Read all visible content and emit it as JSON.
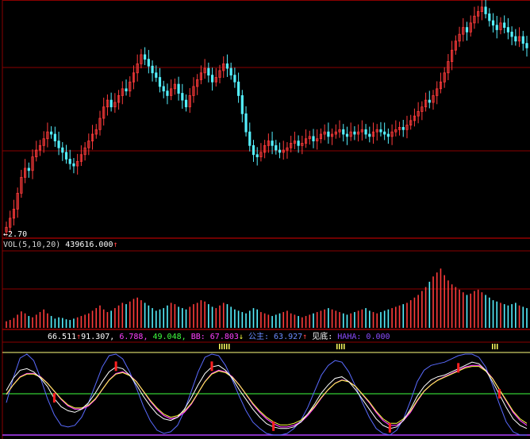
{
  "colors": {
    "up": "#ff3b3b",
    "down": "#54f0ff",
    "grid": "#8a0000",
    "kline": "#ffffff",
    "dline": "#ffff40",
    "jline": "#ff40ff",
    "bline": "#5a6bff",
    "green": "#40ff40"
  },
  "price_panel": {
    "low_label": "2.70"
  },
  "volume_panel": {
    "title": "VOL(5,10,20)",
    "value": "439616.000",
    "arrow": "↑"
  },
  "indicator_panel": {
    "v1": "66.511",
    "a1": "↑",
    "v2": "91.307,",
    "v3": "6.788,",
    "v4": "49.048,",
    "bb_label": "BB:",
    "bb_value": "67.803",
    "a2": "↓",
    "gz_label": "公主:",
    "gz_value": "63.927",
    "a3": "↑",
    "jd_label": "见底:",
    "haha_label": "HAHA:",
    "haha_value": "0.000"
  },
  "chart_data": {
    "type": "candlestick",
    "price_low_marker": 2.7,
    "note_values": "Bars read approximately from screenshot (relative scale)",
    "candles_close": [
      0.02,
      0.06,
      0.1,
      0.17,
      0.24,
      0.28,
      0.27,
      0.33,
      0.36,
      0.38,
      0.41,
      0.44,
      0.43,
      0.4,
      0.37,
      0.35,
      0.32,
      0.3,
      0.29,
      0.31,
      0.34,
      0.37,
      0.4,
      0.43,
      0.45,
      0.5,
      0.55,
      0.58,
      0.55,
      0.57,
      0.6,
      0.63,
      0.62,
      0.66,
      0.7,
      0.74,
      0.78,
      0.76,
      0.73,
      0.7,
      0.68,
      0.64,
      0.62,
      0.6,
      0.63,
      0.65,
      0.61,
      0.58,
      0.55,
      0.6,
      0.64,
      0.67,
      0.7,
      0.72,
      0.69,
      0.66,
      0.68,
      0.71,
      0.74,
      0.72,
      0.69,
      0.66,
      0.6,
      0.52,
      0.44,
      0.38,
      0.34,
      0.33,
      0.35,
      0.38,
      0.4,
      0.38,
      0.36,
      0.35,
      0.36,
      0.37,
      0.39,
      0.4,
      0.38,
      0.39,
      0.41,
      0.42,
      0.4,
      0.41,
      0.43,
      0.44,
      0.42,
      0.43,
      0.44,
      0.45,
      0.43,
      0.42,
      0.44,
      0.43,
      0.44,
      0.45,
      0.43,
      0.42,
      0.44,
      0.45,
      0.44,
      0.43,
      0.42,
      0.44,
      0.45,
      0.46,
      0.45,
      0.47,
      0.49,
      0.51,
      0.53,
      0.55,
      0.58,
      0.57,
      0.6,
      0.63,
      0.66,
      0.7,
      0.75,
      0.8,
      0.84,
      0.87,
      0.9,
      0.88,
      0.92,
      0.95,
      0.97,
      0.99,
      0.96,
      0.93,
      0.91,
      0.89,
      0.92,
      0.9,
      0.88,
      0.86,
      0.84,
      0.86,
      0.83,
      0.81
    ],
    "volume": [
      0.1,
      0.12,
      0.15,
      0.2,
      0.25,
      0.22,
      0.18,
      0.16,
      0.2,
      0.24,
      0.28,
      0.22,
      0.18,
      0.14,
      0.16,
      0.15,
      0.13,
      0.12,
      0.14,
      0.16,
      0.18,
      0.2,
      0.22,
      0.26,
      0.3,
      0.34,
      0.28,
      0.24,
      0.26,
      0.3,
      0.34,
      0.38,
      0.36,
      0.4,
      0.44,
      0.46,
      0.42,
      0.38,
      0.34,
      0.3,
      0.26,
      0.28,
      0.3,
      0.34,
      0.38,
      0.36,
      0.32,
      0.3,
      0.28,
      0.32,
      0.36,
      0.38,
      0.42,
      0.4,
      0.36,
      0.32,
      0.3,
      0.34,
      0.38,
      0.36,
      0.32,
      0.28,
      0.26,
      0.24,
      0.22,
      0.26,
      0.3,
      0.28,
      0.24,
      0.22,
      0.2,
      0.18,
      0.2,
      0.22,
      0.24,
      0.26,
      0.22,
      0.2,
      0.18,
      0.16,
      0.18,
      0.2,
      0.22,
      0.24,
      0.26,
      0.28,
      0.3,
      0.28,
      0.26,
      0.24,
      0.22,
      0.2,
      0.22,
      0.24,
      0.26,
      0.28,
      0.3,
      0.26,
      0.24,
      0.22,
      0.24,
      0.26,
      0.28,
      0.3,
      0.32,
      0.34,
      0.36,
      0.38,
      0.42,
      0.46,
      0.5,
      0.56,
      0.62,
      0.7,
      0.78,
      0.84,
      0.9,
      0.8,
      0.72,
      0.66,
      0.62,
      0.58,
      0.54,
      0.5,
      0.52,
      0.56,
      0.58,
      0.54,
      0.5,
      0.46,
      0.42,
      0.4,
      0.38,
      0.36,
      0.34,
      0.36,
      0.38,
      0.34,
      0.32,
      0.3
    ],
    "osc_k": [
      0.55,
      0.7,
      0.8,
      0.82,
      0.78,
      0.7,
      0.6,
      0.45,
      0.35,
      0.3,
      0.28,
      0.32,
      0.4,
      0.52,
      0.66,
      0.78,
      0.84,
      0.82,
      0.74,
      0.62,
      0.48,
      0.36,
      0.26,
      0.2,
      0.18,
      0.22,
      0.32,
      0.46,
      0.62,
      0.76,
      0.84,
      0.86,
      0.8,
      0.7,
      0.56,
      0.44,
      0.32,
      0.22,
      0.14,
      0.1,
      0.08,
      0.08,
      0.1,
      0.16,
      0.26,
      0.38,
      0.52,
      0.62,
      0.7,
      0.72,
      0.66,
      0.56,
      0.44,
      0.32,
      0.2,
      0.12,
      0.08,
      0.1,
      0.18,
      0.32,
      0.48,
      0.6,
      0.68,
      0.72,
      0.74,
      0.78,
      0.82,
      0.86,
      0.9,
      0.88,
      0.8,
      0.66,
      0.5,
      0.34,
      0.2,
      0.12,
      0.08
    ],
    "osc_d": [
      0.5,
      0.62,
      0.72,
      0.76,
      0.76,
      0.72,
      0.64,
      0.54,
      0.44,
      0.36,
      0.32,
      0.32,
      0.36,
      0.44,
      0.56,
      0.68,
      0.76,
      0.78,
      0.74,
      0.66,
      0.54,
      0.42,
      0.32,
      0.24,
      0.2,
      0.22,
      0.28,
      0.38,
      0.52,
      0.66,
      0.76,
      0.8,
      0.78,
      0.72,
      0.62,
      0.5,
      0.38,
      0.28,
      0.2,
      0.14,
      0.1,
      0.1,
      0.12,
      0.16,
      0.24,
      0.34,
      0.46,
      0.56,
      0.64,
      0.68,
      0.66,
      0.6,
      0.5,
      0.4,
      0.28,
      0.18,
      0.12,
      0.12,
      0.18,
      0.28,
      0.42,
      0.54,
      0.62,
      0.68,
      0.72,
      0.76,
      0.8,
      0.84,
      0.86,
      0.86,
      0.8,
      0.7,
      0.56,
      0.42,
      0.28,
      0.18,
      0.12
    ],
    "osc_b": [
      0.4,
      0.7,
      0.95,
      1.0,
      0.92,
      0.7,
      0.45,
      0.25,
      0.12,
      0.1,
      0.12,
      0.22,
      0.4,
      0.62,
      0.84,
      0.98,
      1.0,
      0.94,
      0.78,
      0.58,
      0.36,
      0.18,
      0.06,
      0.02,
      0.04,
      0.12,
      0.3,
      0.54,
      0.78,
      0.96,
      1.0,
      0.98,
      0.86,
      0.68,
      0.48,
      0.3,
      0.16,
      0.08,
      0.02,
      0.0,
      0.0,
      0.02,
      0.08,
      0.18,
      0.34,
      0.54,
      0.74,
      0.86,
      0.92,
      0.9,
      0.78,
      0.6,
      0.4,
      0.22,
      0.08,
      0.02,
      0.0,
      0.06,
      0.2,
      0.42,
      0.66,
      0.8,
      0.86,
      0.88,
      0.9,
      0.94,
      0.98,
      1.0,
      1.0,
      0.96,
      0.84,
      0.62,
      0.38,
      0.16,
      0.04,
      0.0,
      0.0
    ]
  }
}
